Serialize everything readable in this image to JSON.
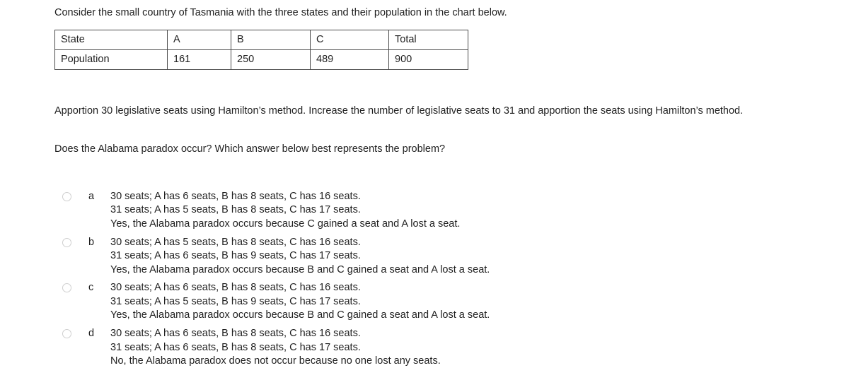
{
  "intro": "Consider the small country of Tasmania with the three states and their population in the chart below.",
  "table": {
    "rows": [
      {
        "label": "State",
        "a": "A",
        "b": "B",
        "c": "C",
        "total": "Total"
      },
      {
        "label": "Population",
        "a": "161",
        "b": "250",
        "c": "489",
        "total": "900"
      }
    ]
  },
  "prompt": "Apportion 30 legislative seats using Hamilton’s method. Increase the number of legislative seats to 31 and apportion the seats using Hamilton’s method.",
  "question": "Does the Alabama paradox occur? Which answer below best represents the problem?",
  "options": [
    {
      "letter": "a",
      "line1": "30 seats; A has 6 seats, B has 8 seats, C has 16 seats.",
      "line2": "31 seats; A has 5 seats, B has 8 seats, C has 17 seats.",
      "line3": "Yes, the Alabama paradox occurs because C gained a seat and A lost a seat."
    },
    {
      "letter": "b",
      "line1": "30 seats; A has 5 seats, B has 8 seats, C has 16 seats.",
      "line2": "31 seats; A has 6 seats, B has 9 seats, C has 17 seats.",
      "line3": "Yes, the Alabama paradox occurs because B and C gained a seat and A lost a seat."
    },
    {
      "letter": "c",
      "line1": "30 seats; A has 6 seats, B has 8 seats, C has 16 seats.",
      "line2": "31 seats; A has 5 seats, B has 9 seats, C has 17 seats.",
      "line3": "Yes, the Alabama paradox occurs because B and C gained a seat and A lost a seat."
    },
    {
      "letter": "d",
      "line1": "30 seats; A has 6 seats, B has 8 seats, C has 16 seats.",
      "line2": "31 seats; A has 6 seats, B has 8 seats, C has 17 seats.",
      "line3": "No, the Alabama paradox does not occur because no one lost any seats."
    }
  ],
  "colors": {
    "text": "#1f1f1f",
    "table_border": "#4a4a4a",
    "radio_border": "#cfcfcf",
    "background": "#ffffff"
  }
}
